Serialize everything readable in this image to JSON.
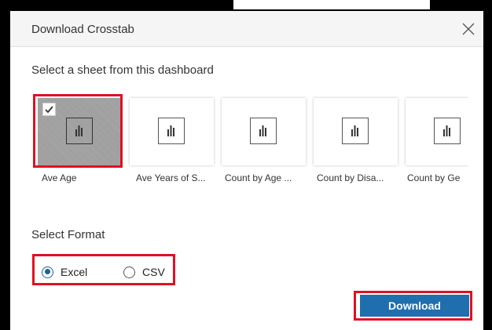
{
  "dialog": {
    "title": "Download Crosstab",
    "sheet_prompt": "Select a sheet from this dashboard",
    "format_prompt": "Select Format",
    "download_label": "Download"
  },
  "sheets": [
    {
      "name": "Ave Age",
      "selected": true
    },
    {
      "name": "Ave Years of S...",
      "selected": false
    },
    {
      "name": "Count by Age ...",
      "selected": false
    },
    {
      "name": "Count by Disa...",
      "selected": false
    },
    {
      "name": "Count by Ge",
      "selected": false
    }
  ],
  "formats": [
    {
      "label": "Excel",
      "checked": true
    },
    {
      "label": "CSV",
      "checked": false
    }
  ],
  "colors": {
    "accent": "#1f6fae",
    "highlight": "#e01020",
    "selected_card": "#a9a9a9"
  }
}
